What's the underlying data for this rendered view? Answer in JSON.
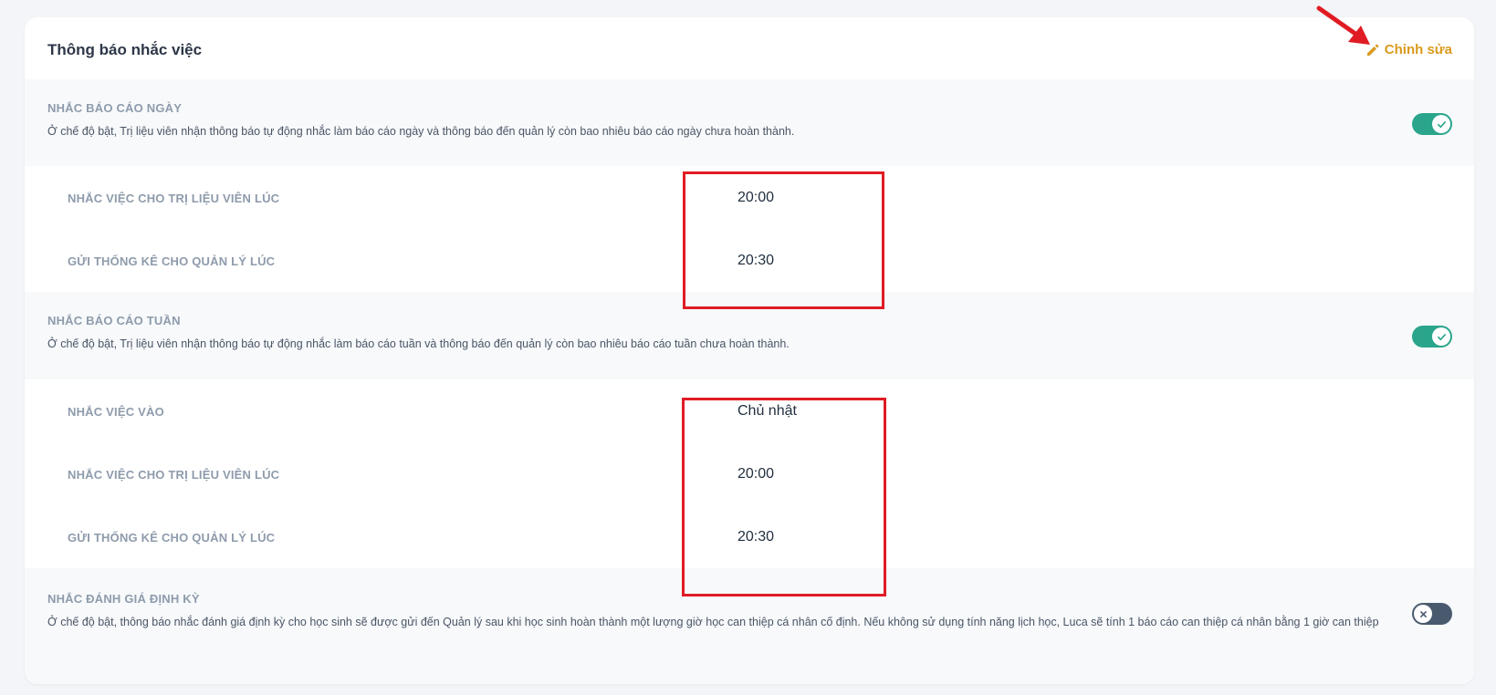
{
  "card": {
    "title": "Thông báo nhắc việc",
    "edit_label": "Chỉnh sửa"
  },
  "daily": {
    "title": "NHẮC BÁO CÁO NGÀY",
    "description": "Ở chế độ bật, Trị liệu viên nhận thông báo tự động nhắc làm báo cáo ngày và thông báo đến quản lý còn bao nhiêu báo cáo ngày chưa hoàn thành.",
    "enabled": true,
    "rows": [
      {
        "label": "NHẮC VIỆC CHO TRỊ LIỆU VIÊN LÚC",
        "value": "20:00"
      },
      {
        "label": "GỬI THỐNG KÊ CHO QUẢN LÝ LÚC",
        "value": "20:30"
      }
    ]
  },
  "weekly": {
    "title": "NHẮC BÁO CÁO TUẦN",
    "description": "Ở chế độ bật, Trị liệu viên nhận thông báo tự động nhắc làm báo cáo tuần và thông báo đến quản lý còn bao nhiêu báo cáo tuần chưa hoàn thành.",
    "enabled": true,
    "rows": [
      {
        "label": "NHẮC VIỆC VÀO",
        "value": "Chủ nhật"
      },
      {
        "label": "NHẮC VIỆC CHO TRỊ LIỆU VIÊN LÚC",
        "value": "20:00"
      },
      {
        "label": "GỬI THỐNG KÊ CHO QUẢN LÝ LÚC",
        "value": "20:30"
      }
    ]
  },
  "periodic": {
    "title": "NHẮC ĐÁNH GIÁ ĐỊNH KỲ",
    "description": "Ở chế độ bật, thông báo nhắc đánh giá định kỳ cho học sinh sẽ được gửi đến Quản lý sau khi học sinh hoàn thành một lượng giờ học can thiệp cá nhân cố định. Nếu không sử dụng tính năng lịch học, Luca sẽ tính 1 báo cáo can thiệp cá nhân bằng 1 giờ can thiệp",
    "enabled": false
  },
  "colors": {
    "accent_edit": "#d99a1d",
    "toggle_on": "#2aa58c",
    "toggle_off": "#4a5a6e",
    "annotation": "#e01b24"
  },
  "icons": {
    "edit": "pencil-icon",
    "toggle_on": "check-icon",
    "toggle_off": "x-icon",
    "annotation": "arrow-icon"
  }
}
